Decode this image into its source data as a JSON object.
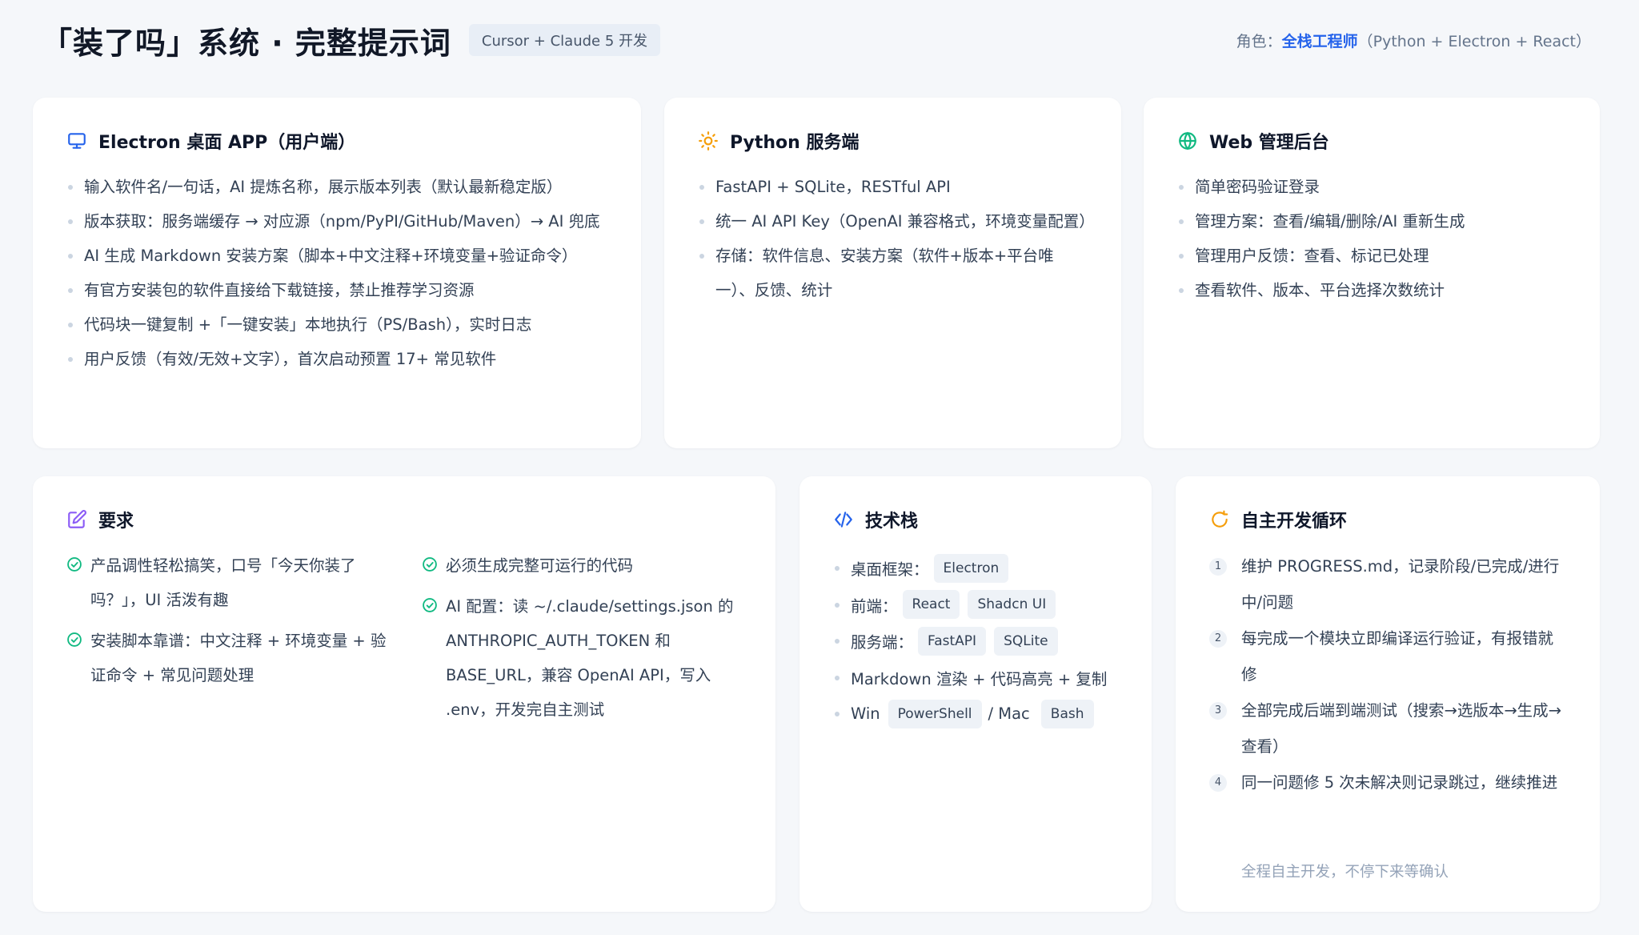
{
  "header": {
    "title": "「装了吗」系统 · 完整提示词",
    "badge": "Cursor + Claude 5 开发",
    "role_prefix": "角色：",
    "role_name": "全栈工程师",
    "role_suffix": "（Python + Electron + React）"
  },
  "colors": {
    "accent": "#2563eb",
    "monitor_icon": "#2563eb",
    "sun_icon": "#f59e0b",
    "globe_icon": "#10b981",
    "edit_icon": "#8b5cf6",
    "code_icon": "#2563eb",
    "loop_icon": "#f59e0b",
    "check_icon": "#10b981"
  },
  "electron": {
    "icon": "monitor-icon",
    "title": "Electron 桌面 APP（用户端）",
    "items": [
      "输入软件名/一句话，AI 提炼名称，展示版本列表（默认最新稳定版）",
      "版本获取：服务端缓存 → 对应源（npm/PyPI/GitHub/Maven）→ AI 兜底",
      "AI 生成 Markdown 安装方案（脚本+中文注释+环境变量+验证命令）",
      "有官方安装包的软件直接给下载链接，禁止推荐学习资源",
      "代码块一键复制 +「一键安装」本地执行（PS/Bash），实时日志",
      "用户反馈（有效/无效+文字），首次启动预置 17+ 常见软件"
    ]
  },
  "python": {
    "icon": "sun-icon",
    "title": "Python 服务端",
    "items": [
      "FastAPI + SQLite，RESTful API",
      "统一 AI API Key（OpenAI 兼容格式，环境变量配置）",
      "存储：软件信息、安装方案（软件+版本+平台唯一）、反馈、统计"
    ]
  },
  "web": {
    "icon": "globe-icon",
    "title": "Web 管理后台",
    "items": [
      "简单密码验证登录",
      "管理方案：查看/编辑/删除/AI 重新生成",
      "管理用户反馈：查看、标记已处理",
      "查看软件、版本、平台选择次数统计"
    ]
  },
  "requirements": {
    "icon": "edit-icon",
    "title": "要求",
    "left": [
      "产品调性轻松搞笑，口号「今天你装了吗？」，UI 活泼有趣",
      "安装脚本靠谱：中文注释 + 环境变量 + 验证命令 + 常见问题处理"
    ],
    "right": [
      "必须生成完整可运行的代码",
      "AI 配置：读 ~/.claude/settings.json 的 ANTHROPIC_AUTH_TOKEN 和 BASE_URL，兼容 OpenAI API，写入 .env，开发完自主测试"
    ]
  },
  "tech": {
    "icon": "code-icon",
    "title": "技术栈",
    "desktop_label": "桌面框架：",
    "desktop_chips": [
      "Electron"
    ],
    "frontend_label": "前端：",
    "frontend_chips": [
      "React",
      "Shadcn UI"
    ],
    "server_label": "服务端：",
    "server_chips": [
      "FastAPI",
      "SQLite"
    ],
    "markdown": "Markdown 渲染 + 代码高亮 + 复制",
    "win_label": "Win",
    "win_chip": "PowerShell",
    "mac_label": "/ Mac",
    "mac_chip": "Bash"
  },
  "loop": {
    "icon": "refresh-icon",
    "title": "自主开发循环",
    "items": [
      {
        "n": "1",
        "text": "维护 PROGRESS.md，记录阶段/已完成/进行中/问题"
      },
      {
        "n": "2",
        "text": "每完成一个模块立即编译运行验证，有报错就修"
      },
      {
        "n": "3",
        "text": "全部完成后端到端测试（搜索→选版本→生成→查看）"
      },
      {
        "n": "4",
        "text": "同一问题修 5 次未解决则记录跳过，继续推进"
      }
    ],
    "note": "全程自主开发，不停下来等确认"
  }
}
